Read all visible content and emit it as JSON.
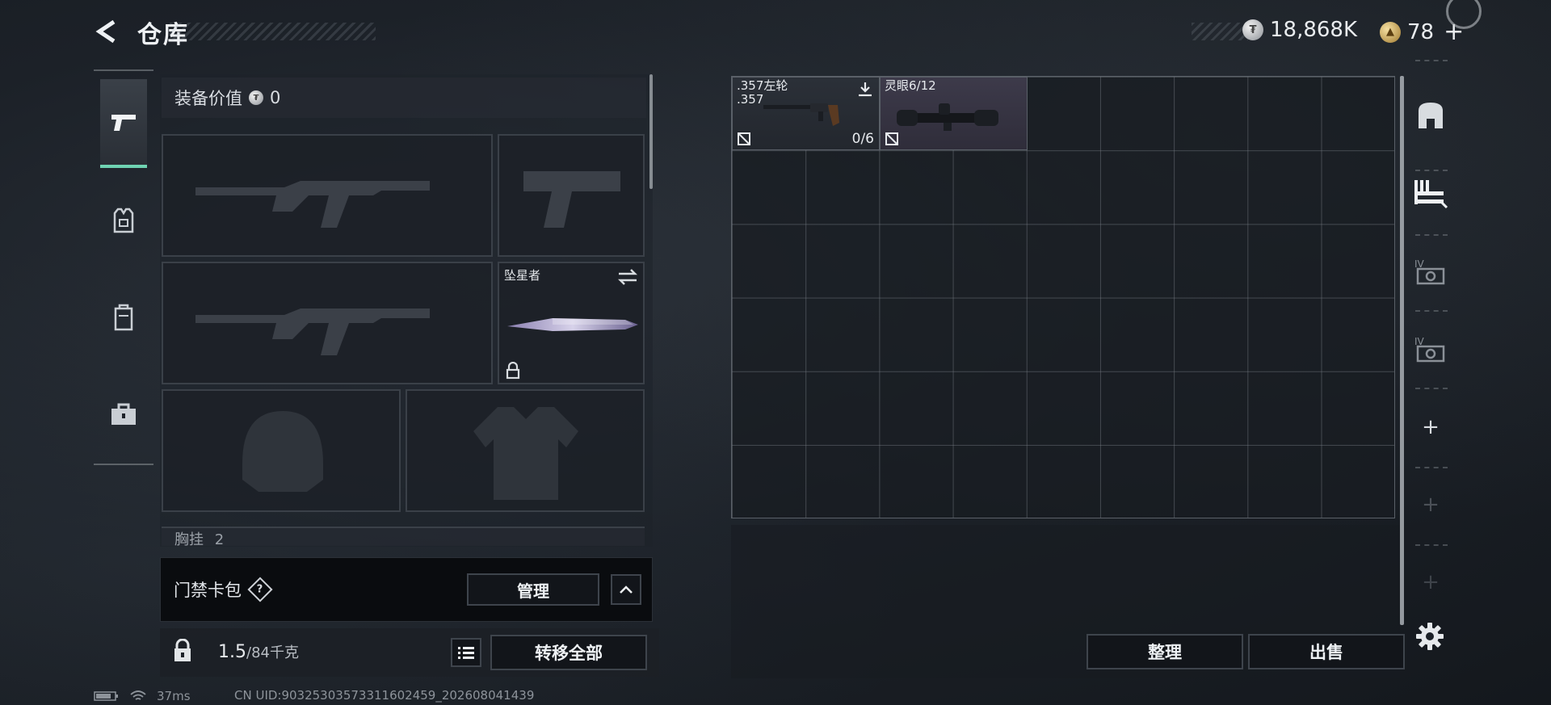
{
  "header": {
    "title": "仓库",
    "silver_amount": "18,868K",
    "gold_amount": "78"
  },
  "equipment": {
    "value_label": "装备价值",
    "value_amount": "0",
    "melee_name": "坠星者",
    "chest_rig_label": "胸挂",
    "chest_rig_count": "2"
  },
  "keycard": {
    "label": "门禁卡包",
    "help": "?",
    "manage_label": "管理"
  },
  "footer": {
    "weight_current": "1.5",
    "weight_max": "/84千克",
    "transfer_all_label": "转移全部",
    "sort_label": "整理",
    "sell_label": "出售"
  },
  "stash": {
    "items": [
      {
        "name": ".357左轮",
        "subname": ".357",
        "count": "0/6"
      },
      {
        "name": "灵眼6/12"
      }
    ]
  },
  "right_rail": {
    "items": [
      "backpack-icon",
      "stash-shelf-icon",
      "container-iv-icon",
      "container-iv-icon"
    ],
    "add_slots": [
      "+",
      "+",
      "+"
    ]
  },
  "status": {
    "ping": "37ms",
    "uid": "CN UID:90325303573311602459_202608041439"
  },
  "colors": {
    "accent": "#6fd3b2",
    "panel": "#1c2128",
    "border": "#3a4048"
  }
}
